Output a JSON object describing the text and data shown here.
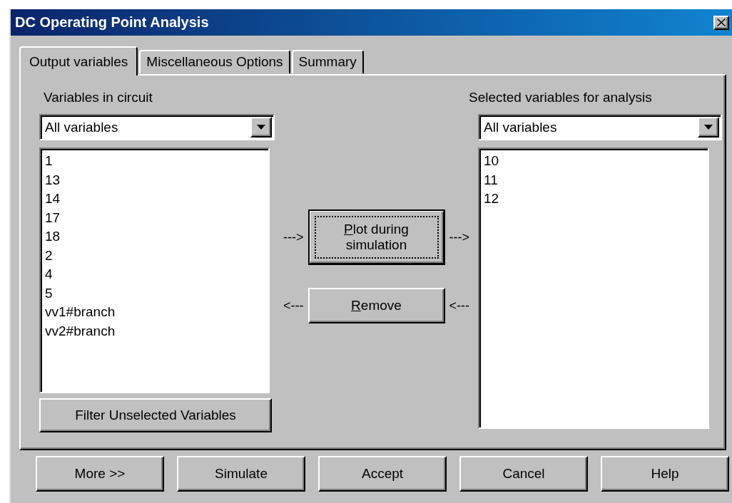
{
  "window": {
    "title": "DC Operating Point Analysis"
  },
  "tabs": [
    {
      "label": "Output variables",
      "selected": true
    },
    {
      "label": "Miscellaneous Options",
      "selected": false
    },
    {
      "label": "Summary",
      "selected": false
    }
  ],
  "circuit_variables": {
    "label": "Variables in circuit",
    "filter": "All variables",
    "items": [
      "1",
      "13",
      "14",
      "17",
      "18",
      "2",
      "4",
      "5",
      "vv1#branch",
      "vv2#branch"
    ],
    "filter_button": "Filter Unselected Variables"
  },
  "transfer_buttons": [
    {
      "label": "Plot during simulation",
      "mnemonic": true,
      "focused": true,
      "arrow_before": "--->",
      "arrow_after": "--->"
    },
    {
      "label": "Remove",
      "mnemonic": true,
      "focused": false,
      "arrow_before": "<---",
      "arrow_after": "<---"
    }
  ],
  "selected_variables": {
    "label": "Selected variables for analysis",
    "filter": "All variables",
    "items": [
      "10",
      "11",
      "12"
    ]
  },
  "buttons": [
    "More >>",
    "Simulate",
    "Accept",
    "Cancel",
    "Help"
  ]
}
